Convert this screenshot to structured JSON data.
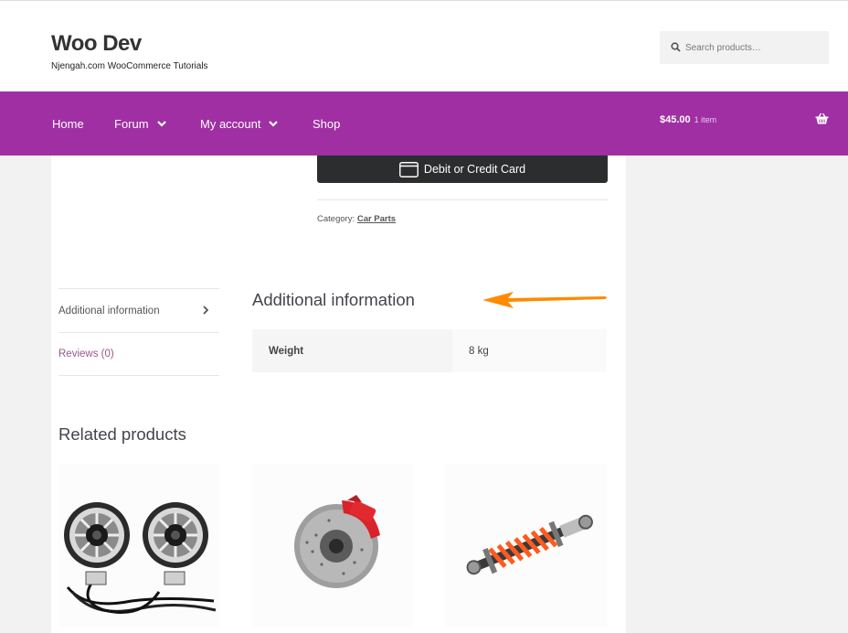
{
  "site": {
    "title": "Woo Dev",
    "description": "Njengah.com WooCommerce Tutorials"
  },
  "search": {
    "placeholder": "Search products…",
    "icon": "search-icon"
  },
  "nav": {
    "items": [
      {
        "label": "Home",
        "has_dropdown": false
      },
      {
        "label": "Forum",
        "has_dropdown": true
      },
      {
        "label": "My account",
        "has_dropdown": true
      },
      {
        "label": "Shop",
        "has_dropdown": false
      }
    ],
    "cart": {
      "amount": "$45.00",
      "count": "1 item",
      "icon": "basket-icon"
    }
  },
  "product": {
    "payment_button": "Debit or Credit Card",
    "category_label": "Category:",
    "category_value": "Car Parts"
  },
  "tabs": [
    {
      "label": "Additional information",
      "active": true
    },
    {
      "label": "Reviews (0)",
      "active": false
    }
  ],
  "panel": {
    "title": "Additional information",
    "attributes": [
      {
        "name": "Weight",
        "value": "8 kg"
      }
    ]
  },
  "related": {
    "title": "Related products",
    "products": [
      {
        "image": "speakers-image"
      },
      {
        "image": "brake-disc-image"
      },
      {
        "image": "shock-absorber-image"
      }
    ]
  },
  "colors": {
    "brand_purple": "#a02fa3",
    "button_dark": "#2c2d2f",
    "annotation_arrow": "#ff8a00",
    "link_purple": "#96588a"
  }
}
